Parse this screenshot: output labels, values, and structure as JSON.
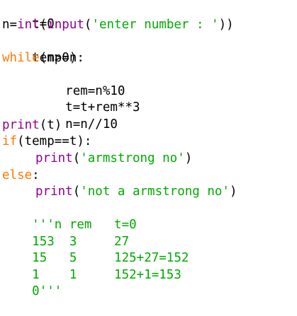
{
  "colors": {
    "keyword": "#ff7700",
    "builtin": "#900090",
    "string": "#00aa00",
    "plain": "#000000",
    "background": "#ffffff"
  },
  "code": {
    "l1": {
      "a": "t=0"
    },
    "l2": {
      "a": "n=",
      "b": "int",
      "c": "(",
      "d": "input",
      "e": "(",
      "f": "'enter number : '",
      "g": "))"
    },
    "l3": {
      "a": "temp=n"
    },
    "l4": {
      "kw": "while",
      "a": "(n>0):"
    },
    "l5": {
      "a": "rem=n%10"
    },
    "l6": {
      "a": "t=t+rem**3"
    },
    "l7": {
      "a": "n=n//10"
    },
    "l8": {
      "bi": "print",
      "a": "(t)"
    },
    "l9": {
      "kw": "if",
      "a": "(temp==t):"
    },
    "l10": {
      "bi": "print",
      "a": "(",
      "s": "'armstrong no'",
      "b": ")"
    },
    "l11": {
      "kw": "else",
      "a": ":"
    },
    "l12": {
      "bi": "print",
      "a": "(",
      "s": "'not a armstrong no'",
      "b": ")"
    },
    "l13": {
      "s": "'''n rem   t=0"
    },
    "l14": {
      "s": "153  3     27"
    },
    "l15": {
      "s": "15   5     125+27=152"
    },
    "l16": {
      "s": "1    1     152+1=153"
    },
    "l17": {
      "s": "0'''"
    }
  }
}
